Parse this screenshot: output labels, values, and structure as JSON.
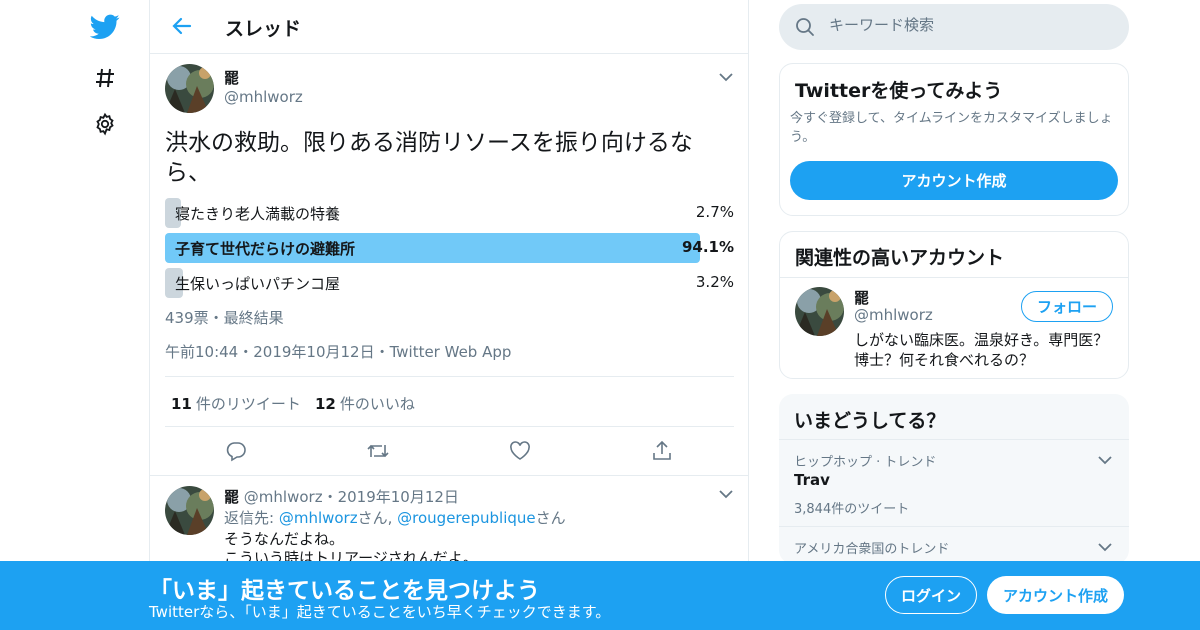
{
  "colors": {
    "accent": "#1da1f2",
    "poll_winner": "#71c9f8",
    "poll_other": "#ccd6dd",
    "border": "#e6ecf0",
    "muted": "#657786"
  },
  "nav": {
    "items": [
      {
        "icon": "twitter-bird-icon"
      },
      {
        "icon": "hashtag-icon"
      },
      {
        "icon": "gear-icon"
      }
    ]
  },
  "header": {
    "title": "スレッド"
  },
  "main_tweet": {
    "name": "罷",
    "handle": "@mhlworz",
    "text": "洪水の救助。限りある消防リソースを振り向けるなら、",
    "poll": {
      "options": [
        {
          "label": "寝たきり老人満載の特養",
          "percent_text": "2.7%",
          "percent": 2.7,
          "winner": false
        },
        {
          "label": "子育て世代だらけの避難所",
          "percent_text": "94.1%",
          "percent": 94.1,
          "winner": true
        },
        {
          "label": "生保いっぱいパチンコ屋",
          "percent_text": "3.2%",
          "percent": 3.2,
          "winner": false
        }
      ],
      "meta": "439票・最終結果"
    },
    "timestamp": "午前10:44・2019年10月12日・Twitter Web App",
    "retweets_count": "11",
    "retweets_label": "件のリツイート",
    "likes_count": "12",
    "likes_label": "件のいいね"
  },
  "reply": {
    "name": "罷",
    "handle_date": "@mhlworz・2019年10月12日",
    "reply_prefix": "返信先: ",
    "reply_to_1": "@mhlworz",
    "reply_mid": "さん, ",
    "reply_to_2": "@rougerepublique",
    "reply_suffix": "さん",
    "line1": "そうなんだよね。",
    "line2": "こういう時はトリアージされんだよ。"
  },
  "search": {
    "placeholder": "キーワード検索"
  },
  "signup_card": {
    "title": "Twitterを使ってみよう",
    "subtitle": "今すぐ登録して、タイムラインをカスタマイズしましょう。",
    "button": "アカウント作成"
  },
  "related_card": {
    "title": "関連性の高いアカウント",
    "name": "罷",
    "handle": "@mhlworz",
    "follow_label": "フォロー",
    "bio": "しがない臨床医。温泉好き。専門医？博士？何それ食べれるの？"
  },
  "trends_card": {
    "title": "いまどうしてる？",
    "items": [
      {
        "context": "ヒップホップ · トレンド",
        "name": "Trav",
        "count": "3,844件のツイート"
      },
      {
        "context": "アメリカ合衆国のトレンド",
        "name": "",
        "count": ""
      }
    ]
  },
  "banner": {
    "title": "「いま」起きていることを見つけよう",
    "subtitle": "Twitterなら、「いま」起きていることをいち早くチェックできます。",
    "login": "ログイン",
    "signup": "アカウント作成"
  }
}
